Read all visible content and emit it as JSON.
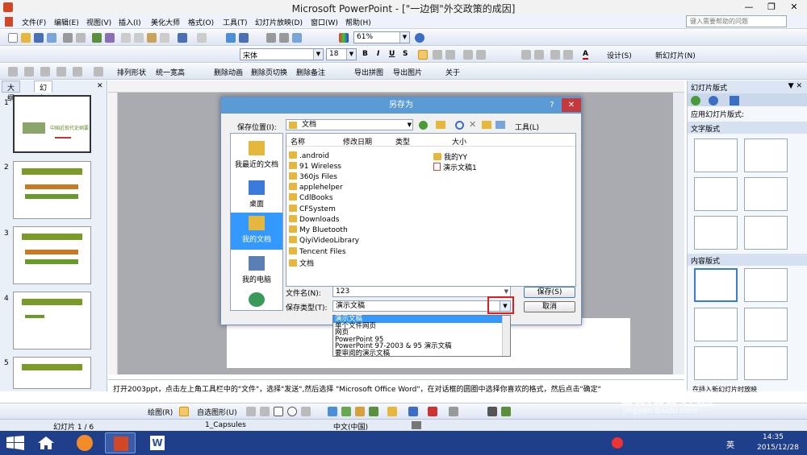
{
  "window": {
    "title": "Microsoft PowerPoint - [\"一边倒\"外交政策的成因]"
  },
  "menu": {
    "items": [
      "文件(F)",
      "编辑(E)",
      "视图(V)",
      "插入(I)",
      "美化大师",
      "格式(O)",
      "工具(T)",
      "幻灯片放映(D)",
      "窗口(W)",
      "帮助(H)"
    ],
    "help_placeholder": "键入需要帮助的问题"
  },
  "toolbar": {
    "zoom": "61%",
    "font": "宋体",
    "font_size": "18",
    "design": "设计(S)",
    "new_slide": "新幻灯片(N)",
    "row3": [
      "排列形状",
      "统一宽高",
      "删除动画",
      "删除页切换",
      "删除备注",
      "导出拼图",
      "导出图片",
      "关于"
    ]
  },
  "left_pane": {
    "tabs": [
      "大纲",
      "幻灯片"
    ],
    "slides": [
      "1",
      "2",
      "3",
      "4",
      "5"
    ],
    "slide1_title": "中国近现代史纲要"
  },
  "right_pane": {
    "title": "幻灯片版式",
    "apply_label": "应用幻灯片版式:",
    "section_text": "文字版式",
    "section_content": "内容版式",
    "bottom_label": "在插入新幻灯片时放映"
  },
  "dialog": {
    "title": "另存为",
    "save_in_label": "保存位置(I):",
    "save_in_value": "文档",
    "tools_label": "工具(L)",
    "columns": [
      "名称",
      "修改日期",
      "类型",
      "大小"
    ],
    "places": [
      "我最近的文档",
      "桌面",
      "我的文档",
      "我的电脑"
    ],
    "files_col1": [
      ".android",
      "91 Wireless",
      "360js Files",
      "applehelper",
      "CdlBooks",
      "CFSystem",
      "Downloads",
      "My Bluetooth",
      "QiyiVideoLibrary",
      "Tencent Files",
      "文档"
    ],
    "files_col2": [
      "我的YY",
      "演示文稿1"
    ],
    "filename_label": "文件名(N):",
    "filename_value": "123",
    "filetype_label": "保存类型(T):",
    "filetype_value": "演示文稿",
    "save_button": "保存(S)",
    "cancel_button": "取消",
    "dropdown_options": [
      "演示文稿",
      "单个文件网页",
      "网页",
      "PowerPoint 95",
      "PowerPoint 97-2003 & 95 演示文稿",
      "要审阅的演示文稿"
    ]
  },
  "notes": {
    "text": "打开2003ppt，点击左上角工具栏中的\"文件\"，选择\"发送\",然后选择     \"Microsoft  Office Word\"，在对话框的圆圈中选择你喜欢的格式，然后点击\"确定\""
  },
  "draw_toolbar": {
    "draw": "绘图(R)",
    "autoshape": "自选图形(U)"
  },
  "status": {
    "slide": "幻灯片 1 / 6",
    "theme": "1_Capsules",
    "language": "中文(中国)"
  },
  "taskbar": {
    "time": "14:35",
    "date": "2015/12/28",
    "ime": "英"
  },
  "watermark": {
    "brand": "Baidu经验",
    "url": "jingyan.baidu.com"
  },
  "colors": {
    "dialog_title": "#5b9bd5",
    "close_red": "#c4393c",
    "selection": "#3399ff",
    "highlight_box": "#e01e1e",
    "taskbar": "#1f3f8a"
  }
}
